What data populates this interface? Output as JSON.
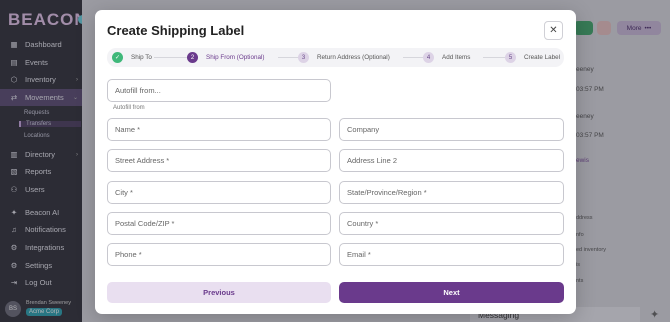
{
  "sidebar": {
    "logo": "BEACON",
    "items": [
      {
        "label": "Dashboard",
        "icon": "dashboard-icon",
        "glyph": "▦"
      },
      {
        "label": "Events",
        "icon": "calendar-icon",
        "glyph": "▤"
      },
      {
        "label": "Inventory",
        "icon": "box-icon",
        "glyph": "⬡"
      },
      {
        "label": "Movements",
        "icon": "arrows-icon",
        "glyph": "⇄"
      },
      {
        "label": "Directory",
        "icon": "book-icon",
        "glyph": "▥"
      },
      {
        "label": "Reports",
        "icon": "chart-icon",
        "glyph": "▧"
      },
      {
        "label": "Users",
        "icon": "users-icon",
        "glyph": "⚇"
      },
      {
        "label": "Beacon AI",
        "icon": "sparkle-icon",
        "glyph": "✦"
      },
      {
        "label": "Notifications",
        "icon": "bell-icon",
        "glyph": "♫"
      },
      {
        "label": "Integrations",
        "icon": "puzzle-icon",
        "glyph": "⚙"
      },
      {
        "label": "Settings",
        "icon": "gear-icon",
        "glyph": "⚙"
      },
      {
        "label": "Log Out",
        "icon": "logout-icon",
        "glyph": "⇥"
      }
    ],
    "movements_subitems": [
      "Requests",
      "Transfers",
      "Locations"
    ],
    "user": {
      "initials": "BS",
      "name": "Brendan Sweeney",
      "org": "Acme Corp"
    }
  },
  "background": {
    "more_label": "More",
    "texts": [
      "eeney",
      "03:57 PM",
      "eeney",
      "03:57 PM",
      "ewis",
      "ddress",
      "nfo",
      "ed inventory",
      "is",
      "nts"
    ],
    "messaging": "Messaging"
  },
  "modal": {
    "title": "Create Shipping Label",
    "steps": [
      {
        "num": "✓",
        "label": "Ship To"
      },
      {
        "num": "2",
        "label": "Ship From (Optional)"
      },
      {
        "num": "3",
        "label": "Return Address (Optional)"
      },
      {
        "num": "4",
        "label": "Add Items"
      },
      {
        "num": "5",
        "label": "Create Label"
      }
    ],
    "autofill_placeholder": "Autofill from...",
    "autofill_hint": "Autofill from",
    "fields": {
      "name": "Name *",
      "company": "Company",
      "street": "Street Address *",
      "address2": "Address Line 2",
      "city": "City *",
      "state": "State/Province/Region *",
      "postal": "Postal Code/ZIP *",
      "country": "Country *",
      "phone": "Phone *",
      "email": "Email *"
    },
    "previous_label": "Previous",
    "next_label": "Next"
  }
}
